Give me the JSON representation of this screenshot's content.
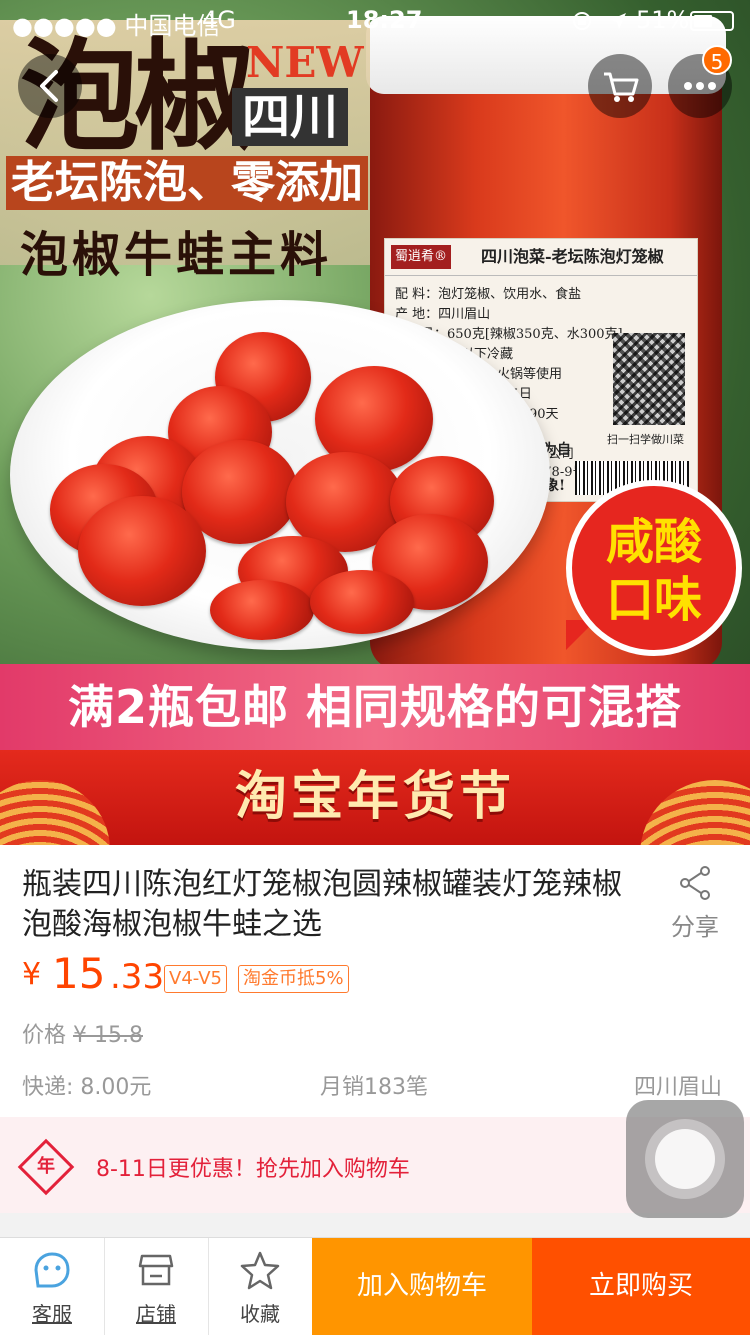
{
  "status_bar": {
    "carrier": "●●●●● 中国电信",
    "network": "4G",
    "time": "18:27",
    "battery": "51%",
    "battery_level": 0.51
  },
  "header": {
    "cart_badge": "5"
  },
  "hero": {
    "title_big": "泡椒",
    "title_new": "NEW",
    "title_region": "四川",
    "tagline": "老坛陈泡、零添加",
    "subtitle": "泡椒牛蛙主料",
    "jar_label": {
      "brand": "蜀逍肴®",
      "header": "四川泡菜-老坛陈泡灯笼椒",
      "lines": [
        "配  料：泡灯笼椒、饮用水、食盐",
        "产  地：四川眉山",
        "净含量：650克[辣椒350克、水300克]",
        "贮  存：0℃以下冷藏",
        "炒、炖、火锅等使用",
        "3月05日",
        "冷藏90天",
        "00074",
        "限公司",
        "178-9号"
      ],
      "qr_caption": "扫一扫学做川菜",
      "side_text": "为自",
      "side_text2": "象!"
    },
    "bubble_line1": "咸酸",
    "bubble_line2": "口味",
    "promo": "满2瓶包邮 相同规格的可混搭",
    "festival": "淘宝年货节"
  },
  "product": {
    "title": "瓶装四川陈泡红灯笼椒泡圆辣椒罐装灯笼辣椒泡酸海椒泡椒牛蛙之选",
    "share_label": "分享",
    "currency": "¥",
    "price_int": "15",
    "price_dec": ".33",
    "tag_vip": "V4-V5",
    "tag_coin": "淘金币抵5%",
    "orig_label": "价格",
    "orig_price": "¥ 15.8",
    "shipping": "快递: 8.00元",
    "monthly_sales": "月销183笔",
    "location": "四川眉山"
  },
  "coupon": {
    "icon_text": "年",
    "text": "8-11日更优惠！抢先加入购物车"
  },
  "bottom_bar": {
    "service": "客服",
    "shop": "店铺",
    "favorite": "收藏",
    "add_cart": "加入购物车",
    "buy_now": "立即购买"
  },
  "colors": {
    "accent": "#ff4400",
    "cart_button": "#ff9500",
    "buy_button": "#ff5000",
    "promo_pink": "#e23a69",
    "festival_red": "#d41d14"
  }
}
